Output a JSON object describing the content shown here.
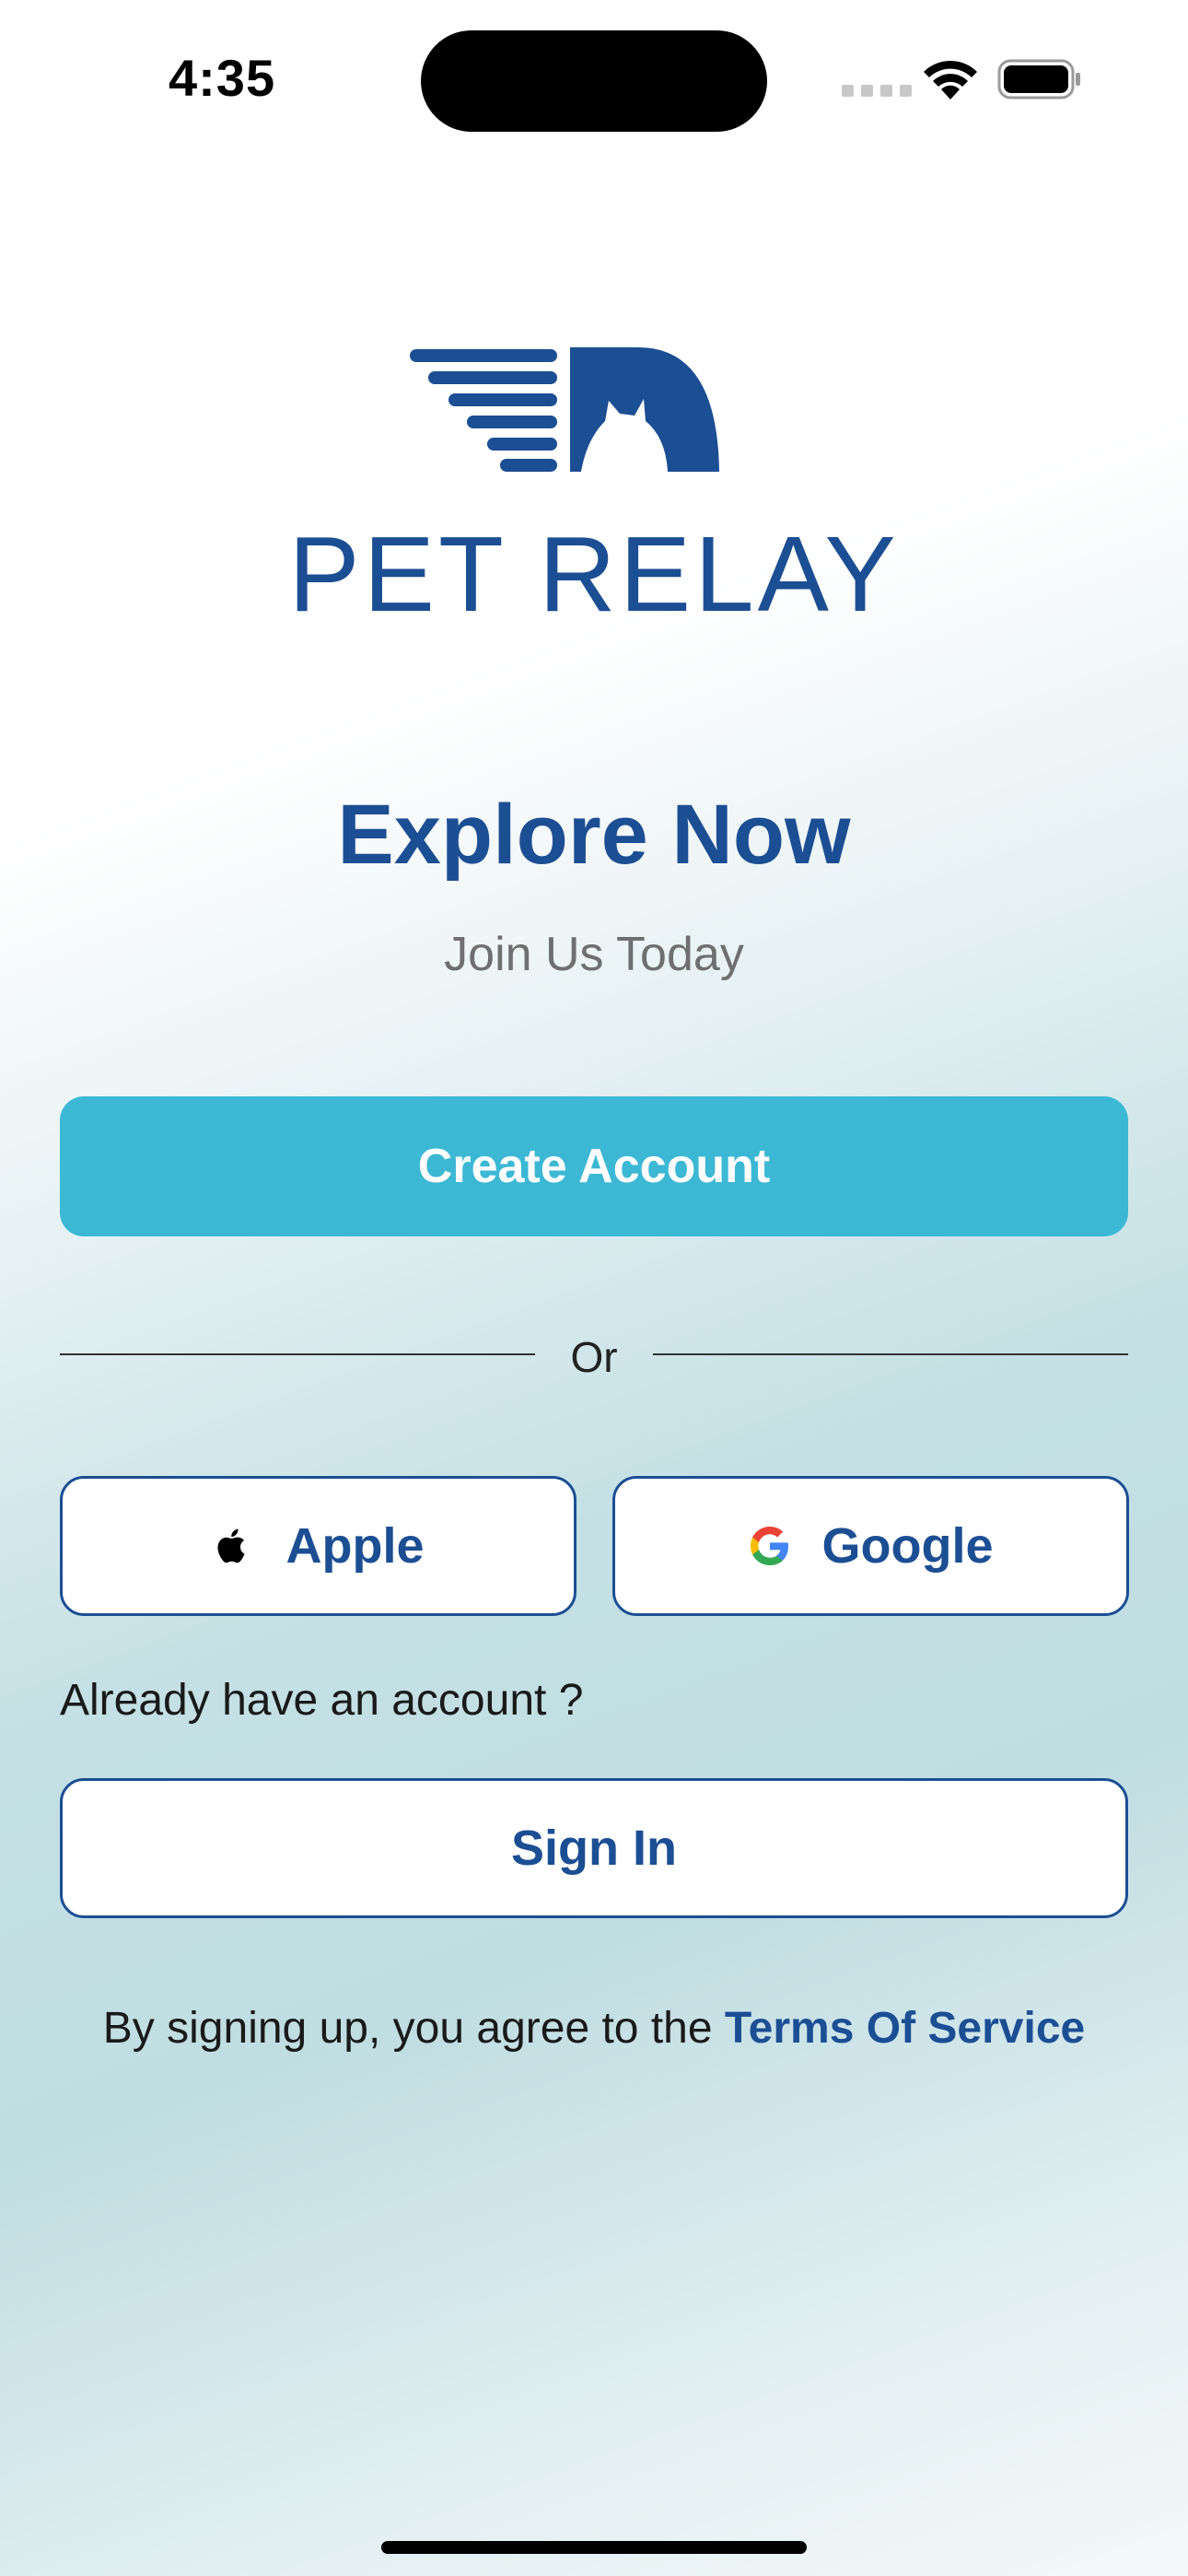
{
  "status_bar": {
    "time": "4:35"
  },
  "brand": {
    "name": "PET RELAY",
    "color": "#1c4e93"
  },
  "hero": {
    "title": "Explore Now",
    "subtitle": "Join Us Today"
  },
  "actions": {
    "create_account": "Create Account",
    "divider": "Or",
    "apple": "Apple",
    "google": "Google",
    "already_prompt": "Already have an account ?",
    "sign_in": "Sign In"
  },
  "terms": {
    "prefix": "By signing up, you agree to the ",
    "link": "Terms Of Service"
  },
  "colors": {
    "primary": "#3cb8d5",
    "brand": "#1c4e93"
  },
  "icons": [
    "wifi-icon",
    "battery-icon",
    "apple-icon",
    "google-icon"
  ]
}
